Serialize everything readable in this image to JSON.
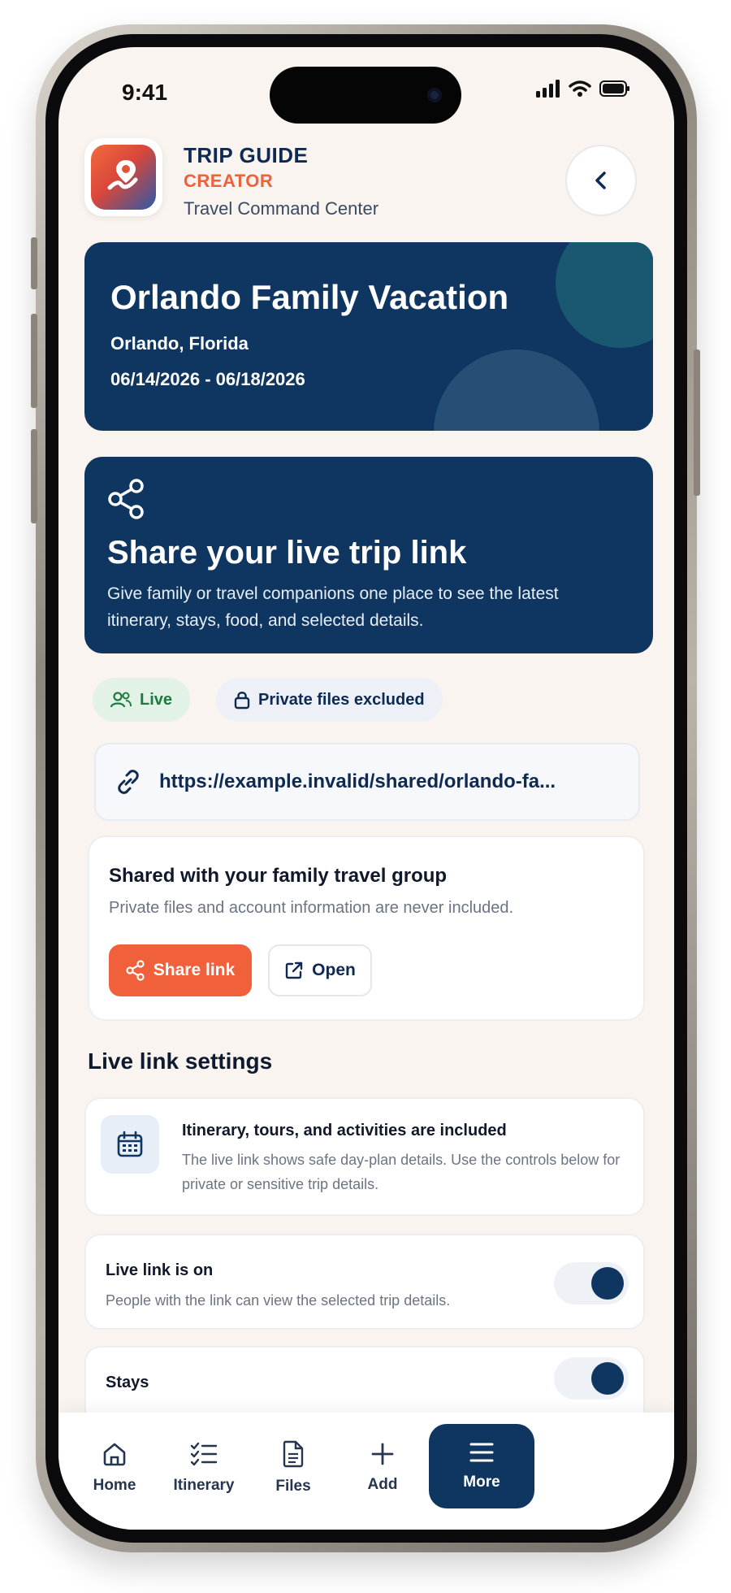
{
  "status_bar": {
    "time": "9:41"
  },
  "header": {
    "brand_title": "TRIP GUIDE",
    "brand_sub": "CREATOR",
    "tagline": "Travel Command Center"
  },
  "trip": {
    "title": "Orlando Family Vacation",
    "location": "Orlando, Florida",
    "dates": "06/14/2026 - 06/18/2026"
  },
  "share": {
    "title": "Share your live trip link",
    "description": "Give family or travel companions one place to see the latest itinerary, stays, food, and selected details."
  },
  "pills": {
    "live": "Live",
    "private": "Private files excluded"
  },
  "link": {
    "url": "https://example.invalid/shared/orlando-fa..."
  },
  "group": {
    "title": "Shared with your family travel group",
    "subtitle": "Private files and account information are never included.",
    "share_button": "Share link",
    "open_button": "Open"
  },
  "settings": {
    "section_title": "Live link settings",
    "info_title": "Itinerary, tours, and activities are included",
    "info_desc": "The live link shows safe day-plan details. Use the controls below for private or sensitive trip details.",
    "live_toggle": {
      "title": "Live link is on",
      "subtitle": "People with the link can view the selected trip details.",
      "on": true
    },
    "stays_toggle": {
      "title": "Stays",
      "on": true
    }
  },
  "nav": {
    "items": [
      {
        "label": "Home",
        "icon": "home-icon"
      },
      {
        "label": "Itinerary",
        "icon": "checklist-icon"
      },
      {
        "label": "Files",
        "icon": "file-icon"
      },
      {
        "label": "Add",
        "icon": "plus-icon"
      },
      {
        "label": "More",
        "icon": "menu-icon"
      }
    ],
    "active": "More"
  },
  "colors": {
    "navy": "#0e3660",
    "accent": "#f0603a",
    "live_green": "#1f7a43",
    "background": "#f9f4ef"
  }
}
